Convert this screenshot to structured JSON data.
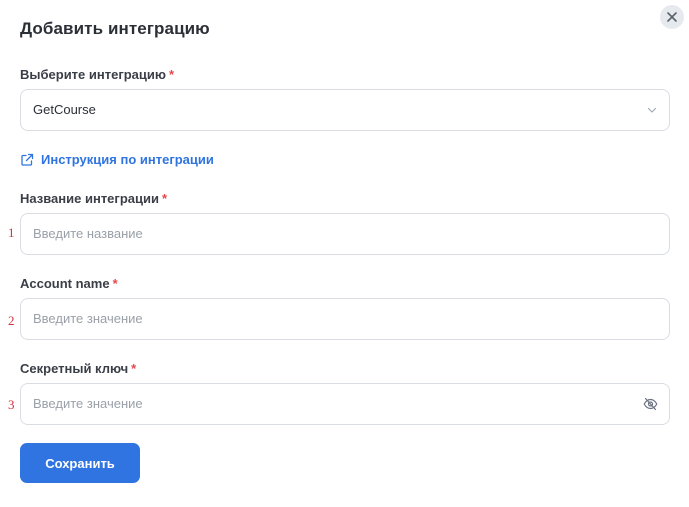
{
  "modal": {
    "title": "Добавить интеграцию"
  },
  "fields": {
    "integration": {
      "label": "Выберите интеграцию",
      "required_mark": "*",
      "value": "GetCourse"
    },
    "instructions_link": "Инструкция по интеграции",
    "name": {
      "label": "Название интеграции",
      "required_mark": "*",
      "placeholder": "Введите название",
      "marker": "1"
    },
    "account": {
      "label": "Account name",
      "required_mark": "*",
      "placeholder": "Введите значение",
      "marker": "2"
    },
    "secret": {
      "label": "Секретный ключ",
      "required_mark": "*",
      "placeholder": "Введите значение",
      "marker": "3"
    }
  },
  "actions": {
    "save_label": "Сохранить"
  },
  "colors": {
    "accent": "#2f74e0",
    "required": "#e5484d",
    "marker": "#d0313b"
  },
  "icons": {
    "close": "close-icon",
    "select_chevron": "chevron-down-icon",
    "link": "external-link-icon",
    "visibility": "eye-off-icon"
  }
}
